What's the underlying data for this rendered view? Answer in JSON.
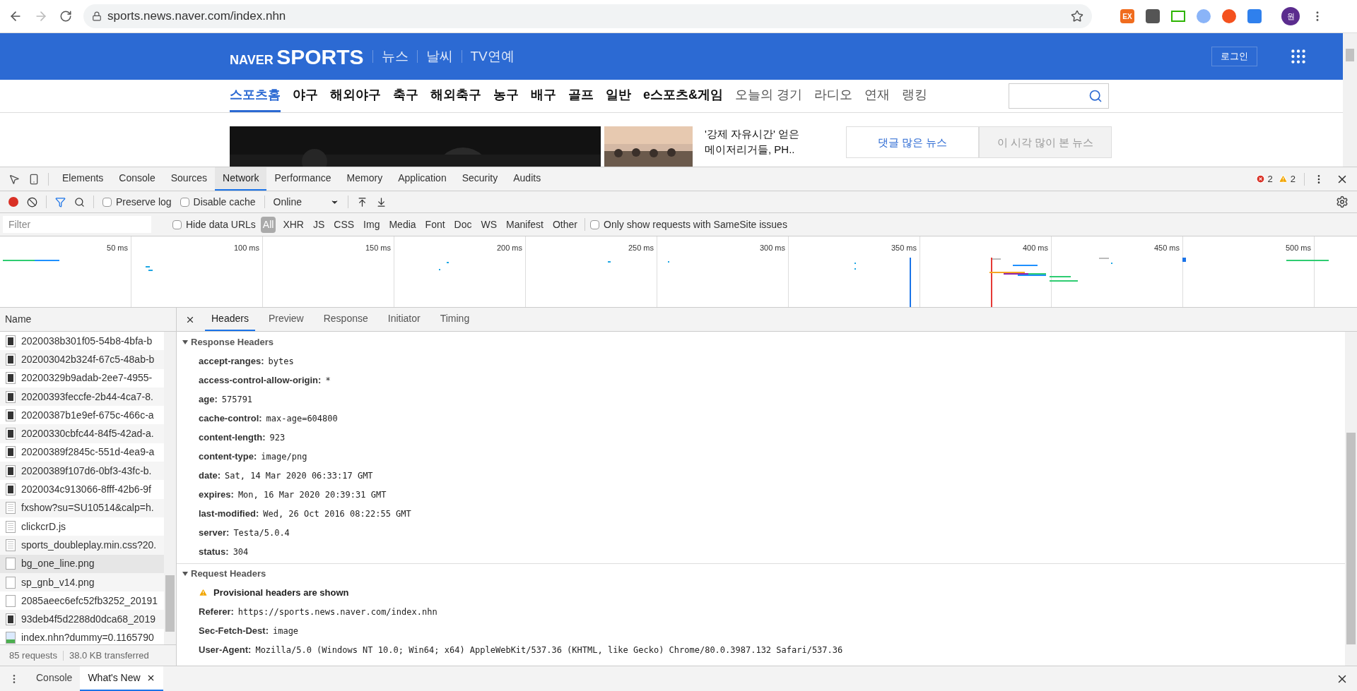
{
  "browser": {
    "url": "sports.news.naver.com/index.nhn",
    "extension_badge": "EX",
    "profile": "원"
  },
  "site": {
    "logo_brand": "NAVER",
    "logo_product": "SPORTS",
    "top_links": [
      "뉴스",
      "날씨",
      "TV연예"
    ],
    "login": "로그인",
    "nav": [
      {
        "label": "스포츠홈",
        "selected": true,
        "kind": "main"
      },
      {
        "label": "야구",
        "selected": false,
        "kind": "main"
      },
      {
        "label": "해외야구",
        "selected": false,
        "kind": "main"
      },
      {
        "label": "축구",
        "selected": false,
        "kind": "main"
      },
      {
        "label": "해외축구",
        "selected": false,
        "kind": "main"
      },
      {
        "label": "농구",
        "selected": false,
        "kind": "main"
      },
      {
        "label": "배구",
        "selected": false,
        "kind": "main"
      },
      {
        "label": "골프",
        "selected": false,
        "kind": "main"
      },
      {
        "label": "일반",
        "selected": false,
        "kind": "main"
      },
      {
        "label": "e스포츠&게임",
        "selected": false,
        "kind": "main"
      },
      {
        "label": "오늘의 경기",
        "selected": false,
        "kind": "extra"
      },
      {
        "label": "라디오",
        "selected": false,
        "kind": "extra"
      },
      {
        "label": "연재",
        "selected": false,
        "kind": "extra"
      },
      {
        "label": "랭킹",
        "selected": false,
        "kind": "extra"
      }
    ],
    "headline_lines": [
      "'강제 자유시간' 얻은",
      "메이저리거들, PH.."
    ],
    "news_tabs": [
      {
        "label": "댓글 많은 뉴스",
        "selected": true
      },
      {
        "label": "이 시각 많이 본 뉴스",
        "selected": false
      }
    ]
  },
  "devtools": {
    "tabs": [
      {
        "label": "Elements",
        "selected": false
      },
      {
        "label": "Console",
        "selected": false
      },
      {
        "label": "Sources",
        "selected": false
      },
      {
        "label": "Network",
        "selected": true
      },
      {
        "label": "Performance",
        "selected": false
      },
      {
        "label": "Memory",
        "selected": false
      },
      {
        "label": "Application",
        "selected": false
      },
      {
        "label": "Security",
        "selected": false
      },
      {
        "label": "Audits",
        "selected": false
      }
    ],
    "errors": "2",
    "warnings": "2",
    "toolbar": {
      "recording": true,
      "options": [
        {
          "label": "Preserve log",
          "checked": false
        },
        {
          "label": "Disable cache",
          "checked": false
        }
      ],
      "throttling": "Online"
    },
    "filter": {
      "placeholder": "Filter",
      "hide_data_urls": {
        "label": "Hide data URLs",
        "checked": false
      },
      "types": [
        {
          "label": "All",
          "selected": true
        },
        {
          "label": "XHR",
          "selected": false
        },
        {
          "label": "JS",
          "selected": false
        },
        {
          "label": "CSS",
          "selected": false
        },
        {
          "label": "Img",
          "selected": false
        },
        {
          "label": "Media",
          "selected": false
        },
        {
          "label": "Font",
          "selected": false
        },
        {
          "label": "Doc",
          "selected": false
        },
        {
          "label": "WS",
          "selected": false
        },
        {
          "label": "Manifest",
          "selected": false
        },
        {
          "label": "Other",
          "selected": false
        }
      ],
      "samesite": {
        "label": "Only show requests with SameSite issues",
        "checked": false
      }
    },
    "timeline_ticks": [
      "50 ms",
      "100 ms",
      "150 ms",
      "200 ms",
      "250 ms",
      "300 ms",
      "350 ms",
      "400 ms",
      "450 ms",
      "500 ms"
    ],
    "requests": {
      "column": "Name",
      "rows": [
        {
          "name": "2020038b301f05-54b8-4bfa-b",
          "kind": "thumbnail",
          "selected": false
        },
        {
          "name": "202003042b324f-67c5-48ab-b",
          "kind": "thumbnail",
          "selected": false
        },
        {
          "name": "20200329b9adab-2ee7-4955-",
          "kind": "thumbnail",
          "selected": false
        },
        {
          "name": "20200393feccfe-2b44-4ca7-8.",
          "kind": "thumbnail",
          "selected": false
        },
        {
          "name": "20200387b1e9ef-675c-466c-a",
          "kind": "thumbnail",
          "selected": false
        },
        {
          "name": "20200330cbfc44-84f5-42ad-a.",
          "kind": "thumbnail",
          "selected": false
        },
        {
          "name": "20200389f2845c-551d-4ea9-a",
          "kind": "thumbnail",
          "selected": false
        },
        {
          "name": "20200389f107d6-0bf3-43fc-b.",
          "kind": "thumbnail",
          "selected": false
        },
        {
          "name": "2020034c913066-8fff-42b6-9f",
          "kind": "thumbnail",
          "selected": false
        },
        {
          "name": "fxshow?su=SU10514&calp=h.",
          "kind": "document",
          "selected": false
        },
        {
          "name": "clickcrD.js",
          "kind": "document",
          "selected": false
        },
        {
          "name": "sports_doubleplay.min.css?20.",
          "kind": "document",
          "selected": false
        },
        {
          "name": "bg_one_line.png",
          "kind": "blank",
          "selected": true
        },
        {
          "name": "sp_gnb_v14.png",
          "kind": "blank",
          "selected": false
        },
        {
          "name": "2085aeec6efc52fb3252_20191",
          "kind": "blank",
          "selected": false
        },
        {
          "name": "93deb4f5d2288d0dca68_2019",
          "kind": "thumbnail",
          "selected": false
        },
        {
          "name": "index.nhn?dummy=0.1165790",
          "kind": "broken",
          "selected": false
        }
      ],
      "summary": [
        "85 requests",
        "38.0 KB transferred"
      ]
    },
    "detail_tabs": [
      {
        "label": "Headers",
        "selected": true
      },
      {
        "label": "Preview",
        "selected": false
      },
      {
        "label": "Response",
        "selected": false
      },
      {
        "label": "Initiator",
        "selected": false
      },
      {
        "label": "Timing",
        "selected": false
      }
    ],
    "response_headers": {
      "title": "Response Headers",
      "expanded": true,
      "rows": [
        {
          "name": "accept-ranges:",
          "value": "bytes"
        },
        {
          "name": "access-control-allow-origin:",
          "value": "*"
        },
        {
          "name": "age:",
          "value": "575791"
        },
        {
          "name": "cache-control:",
          "value": "max-age=604800"
        },
        {
          "name": "content-length:",
          "value": "923"
        },
        {
          "name": "content-type:",
          "value": "image/png"
        },
        {
          "name": "date:",
          "value": "Sat, 14 Mar 2020 06:33:17 GMT"
        },
        {
          "name": "expires:",
          "value": "Mon, 16 Mar 2020 20:39:31 GMT"
        },
        {
          "name": "last-modified:",
          "value": "Wed, 26 Oct 2016 08:22:55 GMT"
        },
        {
          "name": "server:",
          "value": "Testa/5.0.4"
        },
        {
          "name": "status:",
          "value": "304"
        }
      ]
    },
    "request_headers": {
      "title": "Request Headers",
      "expanded": true,
      "warning": "Provisional headers are shown",
      "rows": [
        {
          "name": "Referer:",
          "value": "https://sports.news.naver.com/index.nhn"
        },
        {
          "name": "Sec-Fetch-Dest:",
          "value": "image"
        },
        {
          "name": "User-Agent:",
          "value": "Mozilla/5.0 (Windows NT 10.0; Win64; x64) AppleWebKit/537.36 (KHTML, like Gecko) Chrome/80.0.3987.132 Safari/537.36"
        }
      ]
    }
  },
  "drawer_tabs": [
    {
      "label": "Console",
      "selected": false,
      "closable": false
    },
    {
      "label": "What's New",
      "selected": true,
      "closable": true
    }
  ]
}
